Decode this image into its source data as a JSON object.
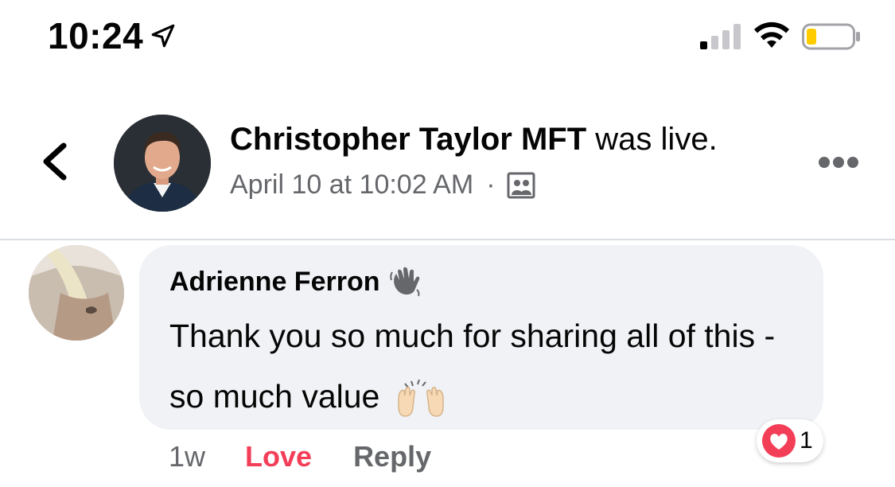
{
  "status_bar": {
    "time": "10:24",
    "icons": [
      "location-arrow-icon",
      "cellular-signal-icon",
      "wifi-icon",
      "battery-low-icon"
    ]
  },
  "post_header": {
    "host_name": "Christopher Taylor MFT",
    "host_status": "was live.",
    "timestamp": "April 10 at 10:02 AM",
    "separator": "·",
    "audience_icon": "group-audience-icon",
    "back_icon": "chevron-left-icon",
    "more_icon": "more-options-icon"
  },
  "comment": {
    "author": "Adrienne Ferron",
    "author_badge_icon": "waving-hand-icon",
    "text": "Thank you so much for sharing all of this - so much value",
    "emoji_icon": "raising-hands-icon",
    "age": "1w",
    "love_label": "Love",
    "reply_label": "Reply",
    "reaction_icon": "love-heart-icon",
    "reaction_count": "1"
  },
  "colors": {
    "love_accent": "#f33e58",
    "meta_gray": "#65676b",
    "bubble_bg": "#f0f2f5",
    "battery_fill": "#ffcc00"
  }
}
